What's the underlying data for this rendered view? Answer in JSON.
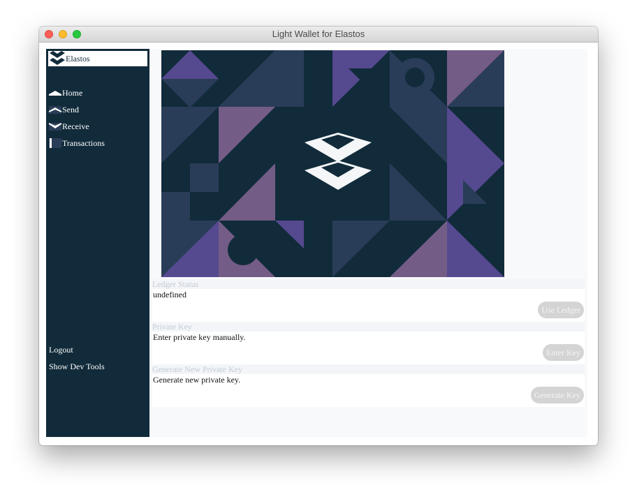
{
  "window": {
    "title": "Light Wallet for Elastos"
  },
  "sidebar": {
    "brand": "Elastos",
    "nav": [
      {
        "label": "Home",
        "icon": "home-icon"
      },
      {
        "label": "Send",
        "icon": "send-icon"
      },
      {
        "label": "Receive",
        "icon": "receive-icon"
      },
      {
        "label": "Transactions",
        "icon": "transactions-icon"
      }
    ],
    "logout": "Logout",
    "dev_tools": "Show Dev Tools"
  },
  "sections": [
    {
      "header": "Ledger Status",
      "text": "undefined",
      "button": "Use Ledger"
    },
    {
      "header": "Private Key",
      "text": "Enter private key manually.",
      "button": "Enter Key"
    },
    {
      "header": "Generate New Private Key",
      "text": "Generate new private key.",
      "button": "Generate Key"
    }
  ],
  "colors": {
    "sidebar_bg": "#112b3a",
    "hero_bg": "#112b3a",
    "hero_navy": "#2a3d58",
    "hero_purple": "#55498f",
    "hero_mauve": "#735c86",
    "button_bg": "#d4d4d4"
  }
}
